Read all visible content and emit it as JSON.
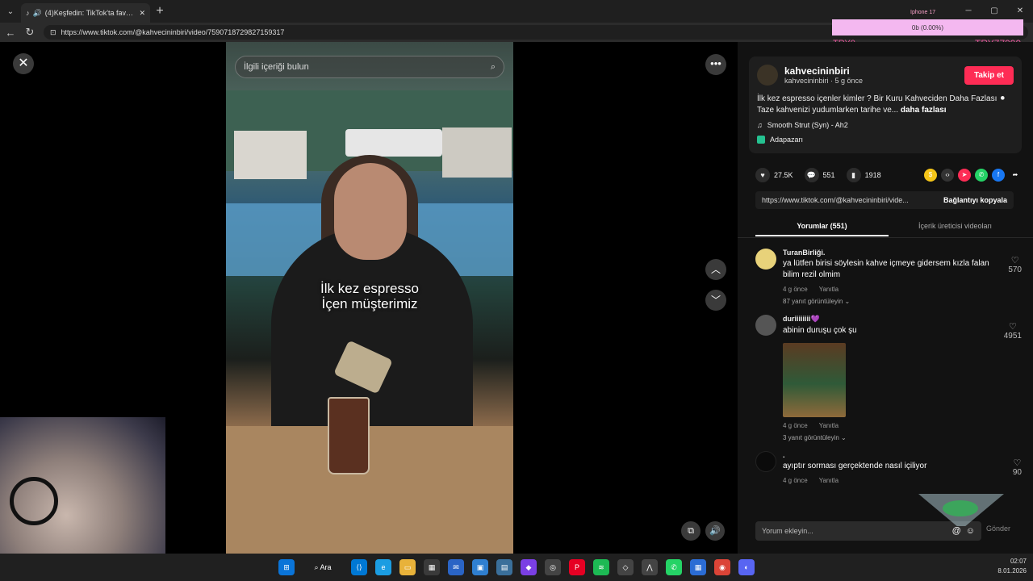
{
  "browser": {
    "tab_title": "(4)Keşfedin: TikTok'ta favori v",
    "new_tab": "+",
    "url": "https://www.tiktok.com/@kahvecininbiri/video/7590718729827159317",
    "win_min": "─",
    "win_max": "▢",
    "win_close": "✕"
  },
  "overlay": {
    "pink_text": "0b (0.00%)",
    "top_text": "Iphone 17",
    "try0": "TRY0",
    "try7": "TRY77999"
  },
  "video": {
    "search_placeholder": "İlgili içeriği bulun",
    "caption_line1": "İlk kez espresso",
    "caption_line2": "İçen müşterimiz",
    "close_icon": "✕",
    "more_icon": "•••",
    "up_icon": "︿",
    "down_icon": "﹀"
  },
  "post": {
    "author": "kahvecininbiri",
    "author_sub": "kahvecininbiri · 5 g önce",
    "follow_label": "Takip et",
    "description": "İlk kez espresso içenler kimler ? Bir Kuru Kahveciden Daha Fazlası ⚫ Taze kahvenizi yudumlarken tarihe ve...",
    "more_label": "daha fazlası",
    "music": "Smooth Strut (Syn) - Ah2",
    "location": "Adapazarı",
    "likes": "27.5K",
    "comments_count": "551",
    "saves": "1918",
    "share_url": "https://www.tiktok.com/@kahvecininbiri/vide...",
    "copy_label": "Bağlantıyı kopyala",
    "tab_comments": "Yorumlar (551)",
    "tab_creator": "İçerik üreticisi videoları"
  },
  "comments": [
    {
      "user": "TuranBirliği.",
      "text": "ya lütfen birisi söylesin kahve içmeye gidersem kızla falan bilim rezil olmim",
      "time": "4 g önce",
      "reply": "Yanıtla",
      "replies": "87 yanıt görüntüleyin",
      "likes": "570",
      "avatar_color": "#e8d27a"
    },
    {
      "user": "duriiiiiiii💜",
      "text": "abinin duruşu çok şu",
      "time": "4 g önce",
      "reply": "Yanıtla",
      "replies": "3 yanıt görüntüleyin",
      "likes": "4951",
      "avatar_color": "#555555"
    },
    {
      "user": ".",
      "text": "ayıptır sorması gerçektende nasıl içiliyor",
      "time": "4 g önce",
      "reply": "Yanıtla",
      "replies": "",
      "likes": "90",
      "avatar_color": "#0b0b0b"
    }
  ],
  "comment_box": {
    "placeholder": "Yorum ekleyin...",
    "send_label": "Gönder"
  },
  "taskbar": {
    "search_label": "Ara",
    "time": "02:07",
    "date": "8.01.2026"
  },
  "colors": {
    "follow": "#fe2c55",
    "panel_bg": "#121212"
  }
}
